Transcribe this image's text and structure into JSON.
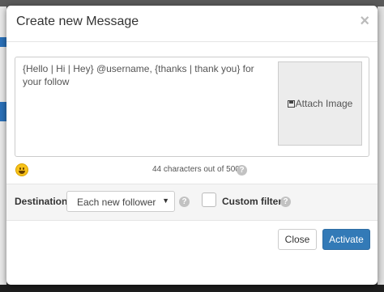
{
  "modal": {
    "title": "Create new Message",
    "close_glyph": "×"
  },
  "editor": {
    "message": "{Hello | Hi | Hey} @username, {thanks | thank you} for your follow",
    "attach_label": "Attach Image"
  },
  "counter": {
    "text": "44 characters out of 500",
    "help_glyph": "?"
  },
  "destination": {
    "label": "Destination",
    "selected": "Each new follower",
    "caret": "▼",
    "help_glyph": "?"
  },
  "custom_filter": {
    "label": "Custom filter",
    "checked": false,
    "help_glyph": "?"
  },
  "footer": {
    "close_label": "Close",
    "activate_label": "Activate"
  },
  "colors": {
    "primary": "#337ab7",
    "emoji": "#f7c21a"
  },
  "icons": {
    "attach": "floppy-disk-icon",
    "emoji": "smiley-icon",
    "help": "question-circle-icon",
    "dismiss": "close-icon"
  }
}
